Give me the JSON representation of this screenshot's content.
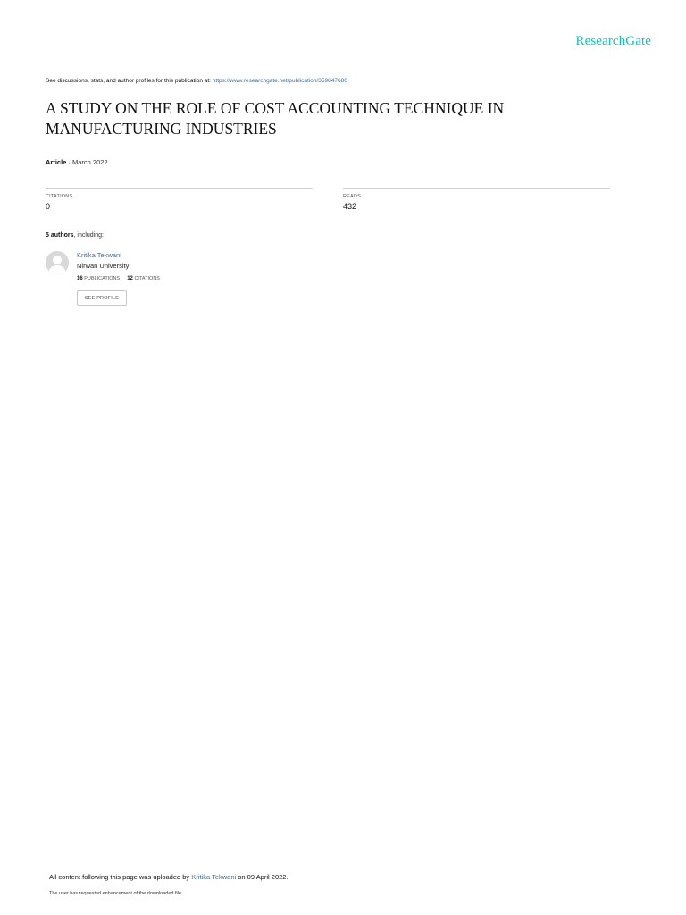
{
  "brand": {
    "logo_text": "ResearchGate",
    "accent_color": "#00ccbb",
    "link_color": "#3a6ea5"
  },
  "header": {
    "discussion_text": "See discussions, stats, and author profiles for this publication at: ",
    "publication_url": "https://www.researchgate.net/publication/359847680"
  },
  "publication": {
    "title_line_1": "A STUDY ON THE ROLE OF COST ACCOUNTING TECHNIQUE IN",
    "title_line_2": "MANUFACTURING INDUSTRIES",
    "type": "Article",
    "date_separator": " · ",
    "date": "March 2022"
  },
  "stats": {
    "citations_label": "CITATIONS",
    "citations_value": "0",
    "reads_label": "READS",
    "reads_value": "432"
  },
  "authors": {
    "count_text": "5 authors",
    "including_text": ", including:",
    "list": [
      {
        "name": "Kritika Tekwani",
        "affiliation": "Nirwan University",
        "publications_count": "16",
        "publications_label": "PUBLICATIONS",
        "citations_count": "12",
        "citations_label": "CITATIONS",
        "see_profile_label": "SEE PROFILE",
        "avatar_icon": "default-user-silhouette-icon"
      }
    ]
  },
  "footer": {
    "upload_prefix": "All content following this page was uploaded by ",
    "uploader_name": "Kritika Tekwani",
    "upload_suffix": " on 09 April 2022.",
    "enhancement_note": "The user has requested enhancement of the downloaded file."
  }
}
